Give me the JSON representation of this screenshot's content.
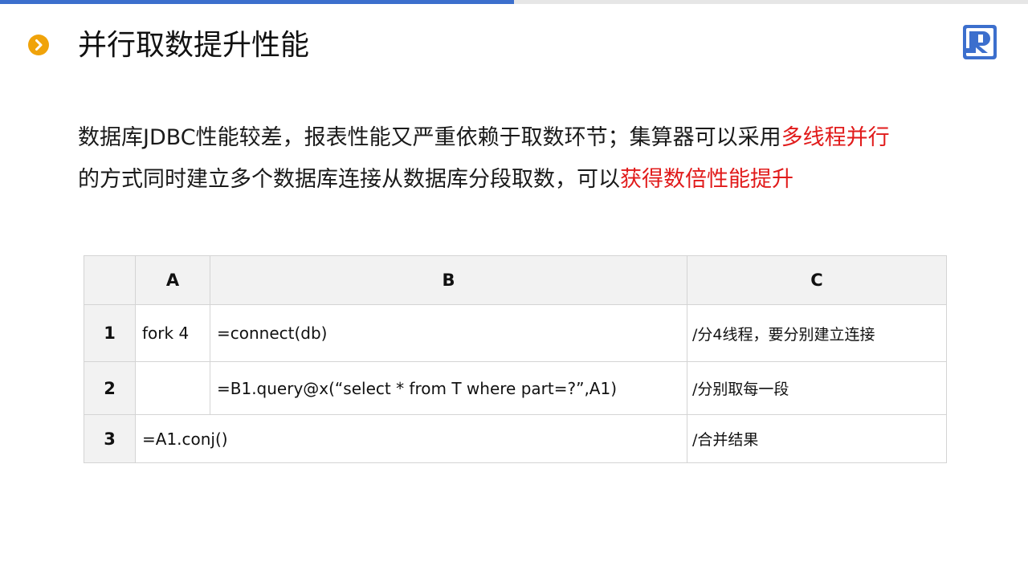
{
  "header": {
    "title": "并行取数提升性能",
    "bullet_icon": "chevron-right-circle-icon",
    "bullet_color": "#f0a30a",
    "logo_icon": "r-logo-icon",
    "logo_color": "#3c6fcd",
    "progress": 0.5,
    "progress_color": "#3c6fcd"
  },
  "description": {
    "line1": "数据库JDBC性能较差，报表性能又严重依赖于取数环节；集算器可以采用",
    "line1_highlight": "多线程并行",
    "line2": "的方式同时建立多个数据库连接从数据库分段取数，可以",
    "line2_highlight": "获得数倍性能提升",
    "highlight_color": "#e11b1b"
  },
  "grid": {
    "columns": [
      "A",
      "B",
      "C"
    ],
    "rows": [
      {
        "num": "1",
        "a": "fork 4",
        "b": "=connect(db)",
        "c": "/分4线程，要分别建立连接"
      },
      {
        "num": "2",
        "a": "",
        "b": "=B1.query@x(“select * from T where part=?”,A1)",
        "c": "/分别取每一段"
      },
      {
        "num": "3",
        "ab": "=A1.conj()",
        "c": "/合并结果"
      }
    ]
  }
}
